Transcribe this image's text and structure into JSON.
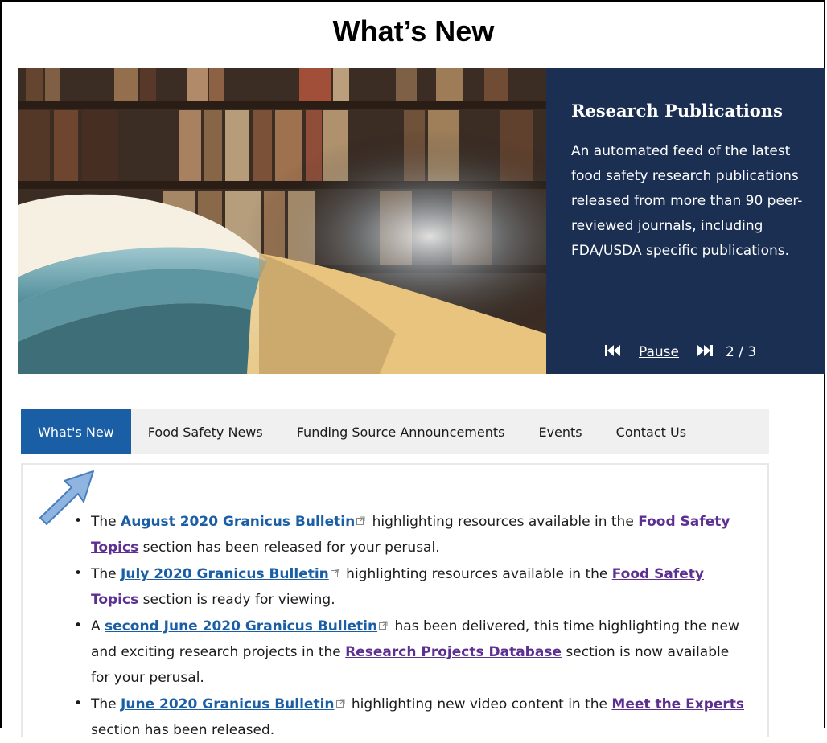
{
  "page": {
    "title": "What’s New"
  },
  "hero": {
    "heading": "Research Publications",
    "description": "An automated feed of the latest food safety research publications released from more than 90 peer-reviewed journals, including FDA/USDA specific publications.",
    "panel_color": "#1b2f52",
    "controls": {
      "prev_icon": "skip-back-icon",
      "pause_label": "Pause",
      "next_icon": "skip-forward-icon",
      "counter": "2 / 3"
    }
  },
  "tabs": [
    {
      "label": "What's New",
      "active": true
    },
    {
      "label": "Food Safety News",
      "active": false
    },
    {
      "label": "Funding Source Announcements",
      "active": false
    },
    {
      "label": "Events",
      "active": false
    },
    {
      "label": "Contact Us",
      "active": false
    }
  ],
  "colors": {
    "accent": "#1a5fa5",
    "visited_link": "#5c2f91",
    "tab_bar": "#f0f0f0"
  },
  "news": [
    {
      "pre": "The ",
      "link": "August 2020 Granicus Bulletin",
      "mid": " highlighting resources available in the ",
      "link2": "Food Safety Topics",
      "post": " section has been released for your perusal."
    },
    {
      "pre": "The ",
      "link": "July 2020 Granicus Bulletin",
      "mid": " highlighting resources available in the ",
      "link2": "Food Safety Topics",
      "post": " section is ready for viewing."
    },
    {
      "pre": "A ",
      "link": "second June 2020 Granicus Bulletin",
      "mid": " has been delivered, this time highlighting the new and exciting research projects in the ",
      "link2": "Research Projects Database",
      "post": " section is now available for your perusal."
    },
    {
      "pre": "The ",
      "link": "June 2020 Granicus Bulletin",
      "mid": " highlighting new video content in the ",
      "link2": "Meet the Experts",
      "post": " section has been released."
    }
  ]
}
